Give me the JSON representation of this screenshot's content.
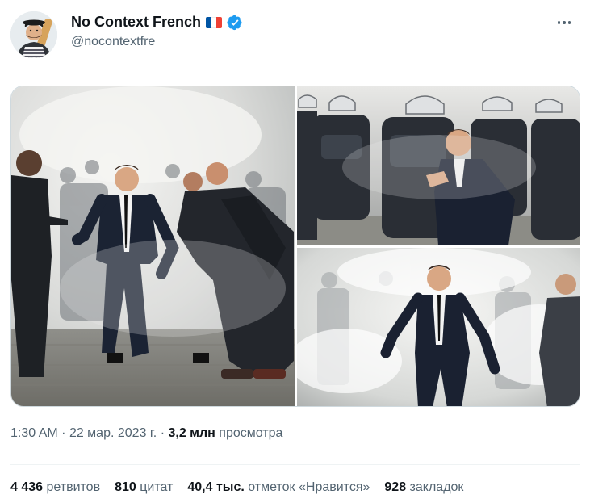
{
  "author": {
    "display_name": "No Context French",
    "handle": "@nocontextfre",
    "flag_colors": [
      "#0055a4",
      "#ffffff",
      "#ef4135"
    ],
    "verified_color": "#1d9bf0",
    "avatar_icon": "avatar-illustration-icon"
  },
  "media": {
    "photos": [
      {
        "name": "photo-1",
        "icon": "protest-photo-icon"
      },
      {
        "name": "photo-2",
        "icon": "riot-police-photo-icon"
      },
      {
        "name": "photo-3",
        "icon": "smoke-running-photo-icon"
      }
    ]
  },
  "meta": {
    "time": "1:30 AM",
    "separator": "·",
    "date": "22 мар. 2023 г.",
    "views_count": "3,2 млн",
    "views_label": "просмотра"
  },
  "stats": {
    "retweets_count": "4 436",
    "retweets_label": "ретвитов",
    "quotes_count": "810",
    "quotes_label": "цитат",
    "likes_count": "40,4 тыс.",
    "likes_label": "отметок «Нравится»",
    "bookmarks_count": "928",
    "bookmarks_label": "закладок"
  }
}
